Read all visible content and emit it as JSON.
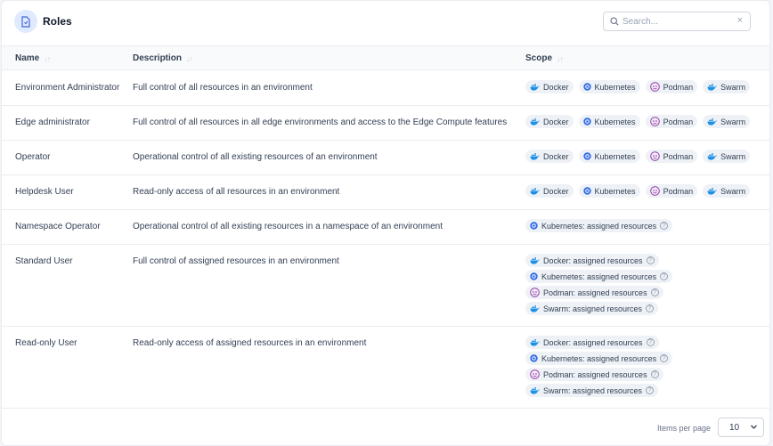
{
  "header": {
    "title": "Roles",
    "search_placeholder": "Search...",
    "clear_symbol": "×"
  },
  "columns": {
    "name": "Name",
    "description": "Description",
    "scope": "Scope",
    "sort_symbol": "↓↑"
  },
  "colors": {
    "docker": "#1d91e6",
    "kubernetes": "#326ce5",
    "podman": "#892ca0",
    "accent": "#3e63dd"
  },
  "rows": [
    {
      "name": "Environment Administrator",
      "description": "Full control of all resources in an environment",
      "scopes": [
        {
          "icon": "docker-icon",
          "label": "Docker"
        },
        {
          "icon": "kubernetes-icon",
          "label": "Kubernetes"
        },
        {
          "icon": "podman-icon",
          "label": "Podman"
        },
        {
          "icon": "swarm-icon",
          "label": "Swarm"
        }
      ]
    },
    {
      "name": "Edge administrator",
      "description": "Full control of all resources in all edge environments and access to the Edge Compute features",
      "scopes": [
        {
          "icon": "docker-icon",
          "label": "Docker"
        },
        {
          "icon": "kubernetes-icon",
          "label": "Kubernetes"
        },
        {
          "icon": "podman-icon",
          "label": "Podman"
        },
        {
          "icon": "swarm-icon",
          "label": "Swarm"
        }
      ]
    },
    {
      "name": "Operator",
      "description": "Operational control of all existing resources of an environment",
      "scopes": [
        {
          "icon": "docker-icon",
          "label": "Docker"
        },
        {
          "icon": "kubernetes-icon",
          "label": "Kubernetes"
        },
        {
          "icon": "podman-icon",
          "label": "Podman"
        },
        {
          "icon": "swarm-icon",
          "label": "Swarm"
        }
      ]
    },
    {
      "name": "Helpdesk User",
      "description": "Read-only access of all resources in an environment",
      "scopes": [
        {
          "icon": "docker-icon",
          "label": "Docker"
        },
        {
          "icon": "kubernetes-icon",
          "label": "Kubernetes"
        },
        {
          "icon": "podman-icon",
          "label": "Podman"
        },
        {
          "icon": "swarm-icon",
          "label": "Swarm"
        }
      ]
    },
    {
      "name": "Namespace Operator",
      "description": "Operational control of all existing resources in a namespace of an environment",
      "scopes": [
        {
          "icon": "kubernetes-icon",
          "label": "Kubernetes: assigned resources"
        }
      ]
    },
    {
      "name": "Standard User",
      "description": "Full control of assigned resources in an environment",
      "scopes": [
        {
          "icon": "docker-icon",
          "label": "Docker: assigned resources"
        },
        {
          "icon": "kubernetes-icon",
          "label": "Kubernetes: assigned resources"
        },
        {
          "icon": "podman-icon",
          "label": "Podman: assigned resources"
        },
        {
          "icon": "swarm-icon",
          "label": "Swarm: assigned resources"
        }
      ]
    },
    {
      "name": "Read-only User",
      "description": "Read-only access of assigned resources in an environment",
      "scopes": [
        {
          "icon": "docker-icon",
          "label": "Docker: assigned resources"
        },
        {
          "icon": "kubernetes-icon",
          "label": "Kubernetes: assigned resources"
        },
        {
          "icon": "podman-icon",
          "label": "Podman: assigned resources"
        },
        {
          "icon": "swarm-icon",
          "label": "Swarm: assigned resources"
        }
      ]
    }
  ],
  "footer": {
    "items_per_page_label": "Items per page",
    "items_per_page_value": "10"
  }
}
